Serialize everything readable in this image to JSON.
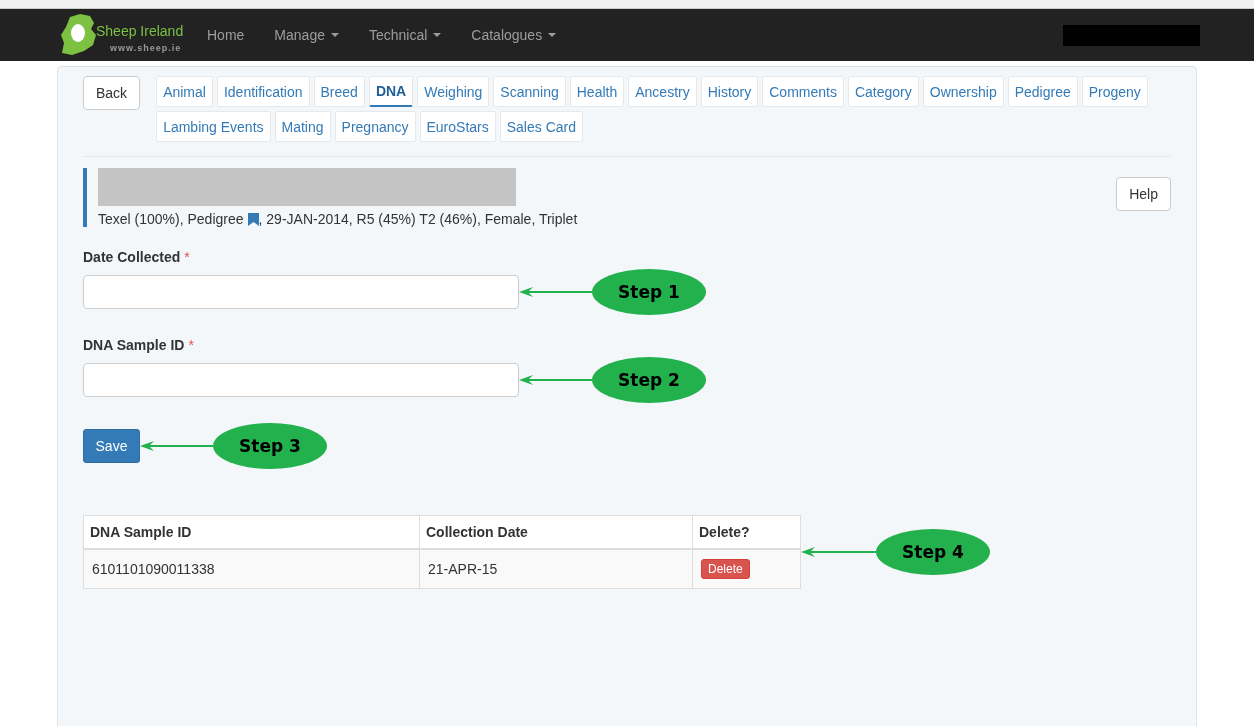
{
  "navbar": {
    "logo": {
      "name": "Sheep Ireland",
      "url": "www.sheep.ie"
    },
    "menu": [
      {
        "label": "Home",
        "dropdown": false
      },
      {
        "label": "Manage",
        "dropdown": true
      },
      {
        "label": "Technical",
        "dropdown": true
      },
      {
        "label": "Catalogues",
        "dropdown": true
      }
    ]
  },
  "back_button": "Back",
  "tabs": [
    {
      "label": "Animal",
      "selected": false
    },
    {
      "label": "Identification",
      "selected": false
    },
    {
      "label": "Breed",
      "selected": false
    },
    {
      "label": "DNA",
      "selected": true
    },
    {
      "label": "Weighing",
      "selected": false
    },
    {
      "label": "Scanning",
      "selected": false
    },
    {
      "label": "Health",
      "selected": false
    },
    {
      "label": "Ancestry",
      "selected": false
    },
    {
      "label": "History",
      "selected": false
    },
    {
      "label": "Comments",
      "selected": false
    },
    {
      "label": "Category",
      "selected": false
    },
    {
      "label": "Ownership",
      "selected": false
    },
    {
      "label": "Pedigree",
      "selected": false
    },
    {
      "label": "Progeny",
      "selected": false
    },
    {
      "label": "Lambing Events",
      "selected": false
    },
    {
      "label": "Mating",
      "selected": false
    },
    {
      "label": "Pregnancy",
      "selected": false
    },
    {
      "label": "EuroStars",
      "selected": false
    },
    {
      "label": "Sales Card",
      "selected": false
    }
  ],
  "animal": {
    "summary_before_icon": "Texel (100%), Pedigree",
    "summary_after_icon": ", 29-JAN-2014, R5 (45%) T2 (46%), Female, Triplet"
  },
  "help_button": "Help",
  "fields": [
    {
      "label": "Date Collected",
      "required_mark": "*",
      "annotation": "Step 1"
    },
    {
      "label": "DNA Sample ID",
      "required_mark": "*",
      "annotation": "Step 2"
    }
  ],
  "save": {
    "label": "Save",
    "annotation": "Step 3"
  },
  "table": {
    "columns": [
      "DNA Sample ID",
      "Collection Date",
      "Delete?"
    ],
    "rows": [
      {
        "sample_id": "6101101090011338",
        "collection_date": "21-APR-15",
        "delete": "Delete"
      }
    ],
    "annotation": "Step 4"
  }
}
